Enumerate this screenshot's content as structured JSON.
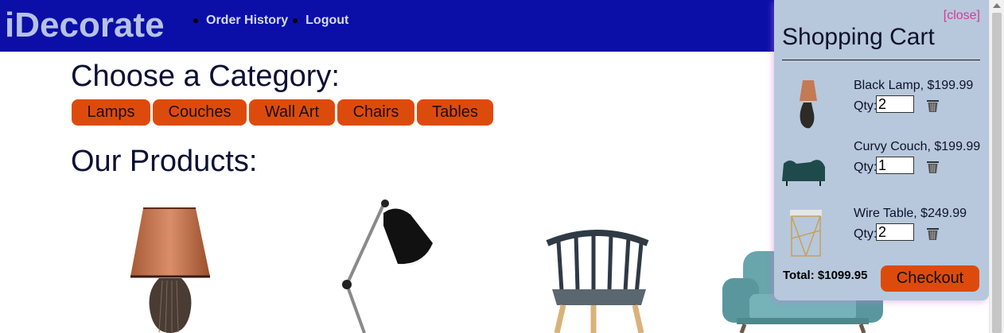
{
  "header": {
    "brand": "iDecorate",
    "nav": [
      {
        "label": "Order History"
      },
      {
        "label": "Logout"
      }
    ]
  },
  "main": {
    "category_heading": "Choose a Category:",
    "categories": [
      "Lamps",
      "Couches",
      "Wall Art",
      "Chairs",
      "Tables"
    ],
    "products_heading": "Our Products:",
    "products": [
      {
        "icon": "table-lamp-image"
      },
      {
        "icon": "desk-lamp-image"
      },
      {
        "icon": "chair-image"
      },
      {
        "icon": "armchair-image"
      }
    ]
  },
  "cart": {
    "close_label": "[close]",
    "title": "Shopping Cart",
    "qty_label": "Qty:",
    "items": [
      {
        "name": "Black Lamp, $199.99",
        "qty": "2",
        "icon": "lamp-thumb"
      },
      {
        "name": "Curvy Couch, $199.99",
        "qty": "1",
        "icon": "couch-thumb"
      },
      {
        "name": "Wire Table, $249.99",
        "qty": "2",
        "icon": "table-thumb"
      }
    ],
    "total_label": "Total: $1099.95",
    "checkout_label": "Checkout"
  },
  "colors": {
    "header_bg": "#0b0fa8",
    "brand_text": "#b6c2e2",
    "accent_button": "#dd4b0c",
    "cart_bg": "#b7c8dc",
    "close_link": "#d63a9c"
  }
}
